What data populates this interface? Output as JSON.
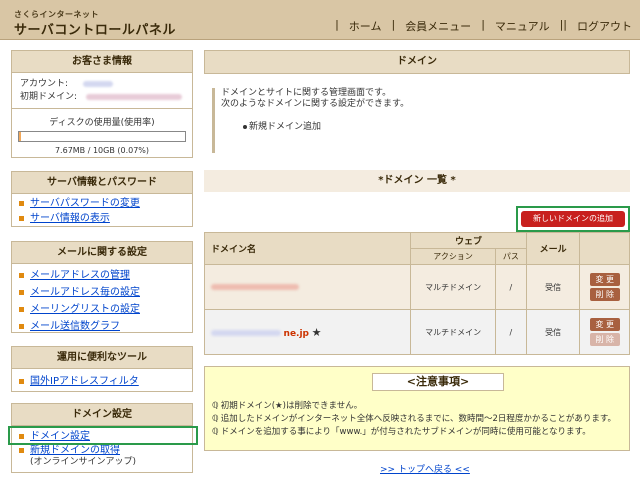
{
  "header": {
    "logo_small": "さくらインターネット",
    "logo_big": "サーバコントロールパネル",
    "nav": [
      "ホーム",
      "会員メニュー",
      "マニュアル",
      "ログアウト"
    ]
  },
  "sidebar": {
    "customer": {
      "title": "お客さま情報",
      "account_label": "アカウント:",
      "domain_label": "初期ドメイン:",
      "disk_label": "ディスクの使用量(使用率)",
      "disk_text": "7.67MB / 10GB (0.07%)",
      "disk_ratio": 0.0007
    },
    "server": {
      "title": "サーバ情報とパスワード",
      "items": [
        "サーバパスワードの変更",
        "サーバ情報の表示"
      ]
    },
    "mail": {
      "title": "メールに関する設定",
      "items": [
        "メールアドレスの管理",
        "メールアドレス毎の設定",
        "メーリングリストの設定",
        "メール送信数グラフ"
      ]
    },
    "tools": {
      "title": "運用に便利なツール",
      "items": [
        "国外IPアドレスフィルタ"
      ]
    },
    "domain": {
      "title": "ドメイン設定",
      "items": [
        "ドメイン設定",
        "新規ドメインの取得"
      ],
      "sub": "(オンラインサインアップ)"
    }
  },
  "main": {
    "header": "ドメイン",
    "intro_line1": "ドメインとサイトに関する管理画面です。",
    "intro_line2": "次のようなドメインに関する設定ができます。",
    "intro_bullet": "新規ドメイン追加",
    "list_title": "*ドメイン 一覧 *",
    "add_button": "新しいドメインの追加",
    "table": {
      "col_domain": "ドメイン名",
      "col_web": "ウェブ",
      "col_action": "アクション",
      "col_path": "パス",
      "col_mail": "メール",
      "rows": [
        {
          "suffix": "",
          "action": "マルチドメイン",
          "path": "/",
          "mail": "受信",
          "btn_change": "変 更",
          "btn_delete": "削 除",
          "star": ""
        },
        {
          "suffix": "ne.jp",
          "action": "マルチドメイン",
          "path": "/",
          "mail": "受信",
          "btn_change": "変 更",
          "btn_delete": "削 除",
          "star": "★"
        }
      ]
    },
    "notice": {
      "title": "<注意事項>",
      "items": [
        "初期ドメイン(★)は削除できません。",
        "追加したドメインがインターネット全体へ反映されるまでに、数時間〜2日程度かかることがあります。",
        "ドメインを追加する事により「www.」が付与されたサブドメインが同時に使用可能となります。"
      ]
    },
    "back_top": ">> トップへ戻る <<"
  }
}
